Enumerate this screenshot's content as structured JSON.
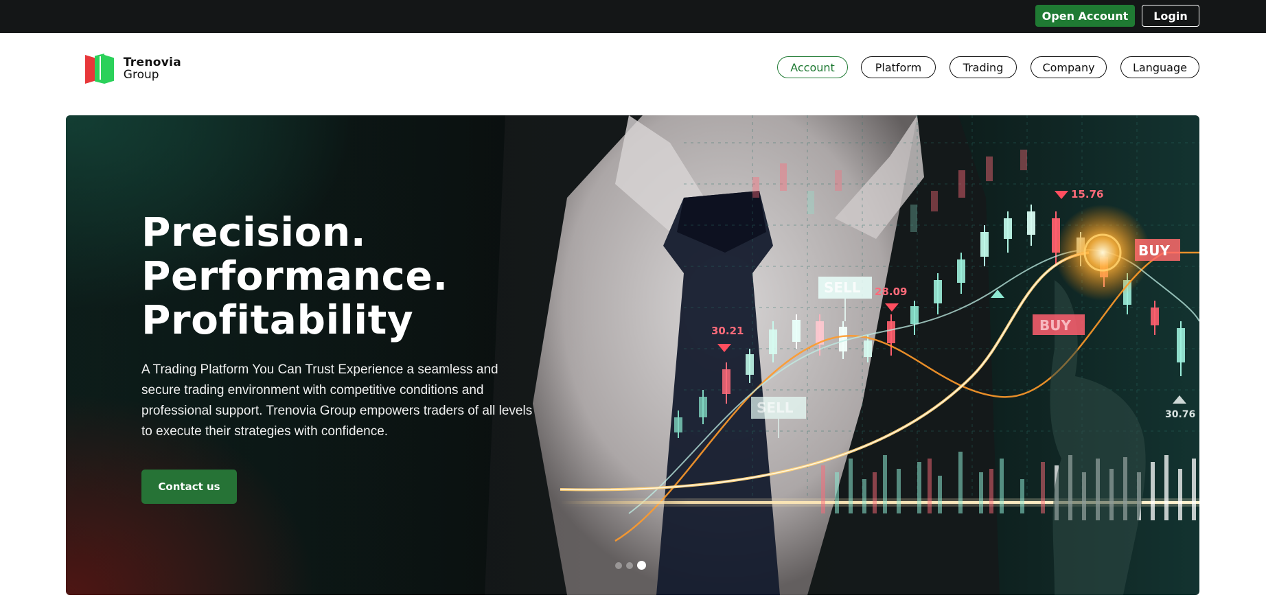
{
  "topbar": {
    "open_account_label": "Open Account",
    "login_label": "Login"
  },
  "brand": {
    "name_line1": "Trenovia",
    "name_line2": "Group"
  },
  "nav": {
    "items": [
      {
        "label": "Account",
        "active": true
      },
      {
        "label": "Platform",
        "active": false
      },
      {
        "label": "Trading",
        "active": false
      },
      {
        "label": "Company",
        "active": false
      },
      {
        "label": "Language",
        "active": false
      }
    ]
  },
  "hero": {
    "title_lines": [
      "Precision.",
      "Performance.",
      "Profitability"
    ],
    "description": "A Trading Platform You Can Trust Experience a seamless and secure trading environment with competitive conditions and professional support. Trenovia Group empowers traders of all levels to execute their strategies with confidence.",
    "cta_label": "Contact us",
    "image_labels": {
      "price_1": "15.76",
      "price_2": "28.09",
      "price_3": "30.21",
      "price_4": "30.76",
      "buy_1": "BUY",
      "buy_2": "BUY",
      "sell_1": "SELL",
      "sell_2": "SELL"
    },
    "carousel": {
      "slide_count": 3,
      "active_index": 2
    }
  },
  "colors": {
    "brand_green": "#1f7a33",
    "topbar_bg": "#141617",
    "logo_red": "#e7373a",
    "logo_green": "#2bd15a"
  }
}
